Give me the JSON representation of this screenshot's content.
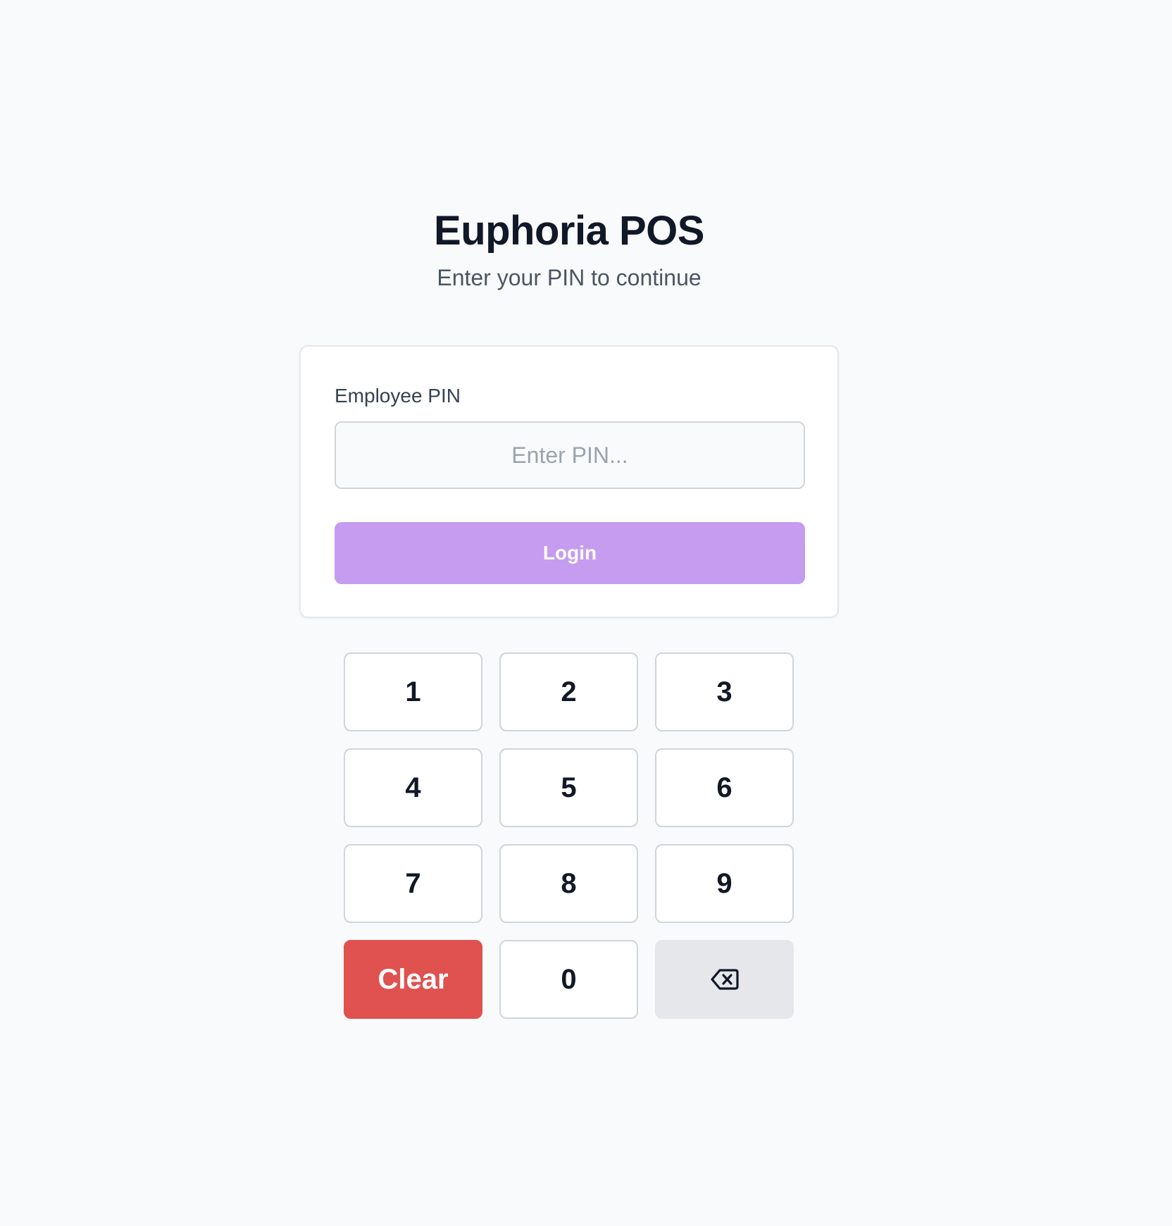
{
  "app": {
    "title": "Euphoria POS",
    "subtitle": "Enter your PIN to continue"
  },
  "login_card": {
    "pin_label": "Employee PIN",
    "pin_value": "",
    "pin_placeholder": "Enter PIN...",
    "login_label": "Login"
  },
  "keypad": {
    "keys": [
      "1",
      "2",
      "3",
      "4",
      "5",
      "6",
      "7",
      "8",
      "9"
    ],
    "clear_label": "Clear",
    "zero_label": "0",
    "backspace_icon": "backspace-icon"
  },
  "colors": {
    "background": "#f9fafb",
    "login_button": "#c59cef",
    "clear_button": "#df524f",
    "backspace_button": "#e5e7eb",
    "text_primary": "#111827"
  }
}
